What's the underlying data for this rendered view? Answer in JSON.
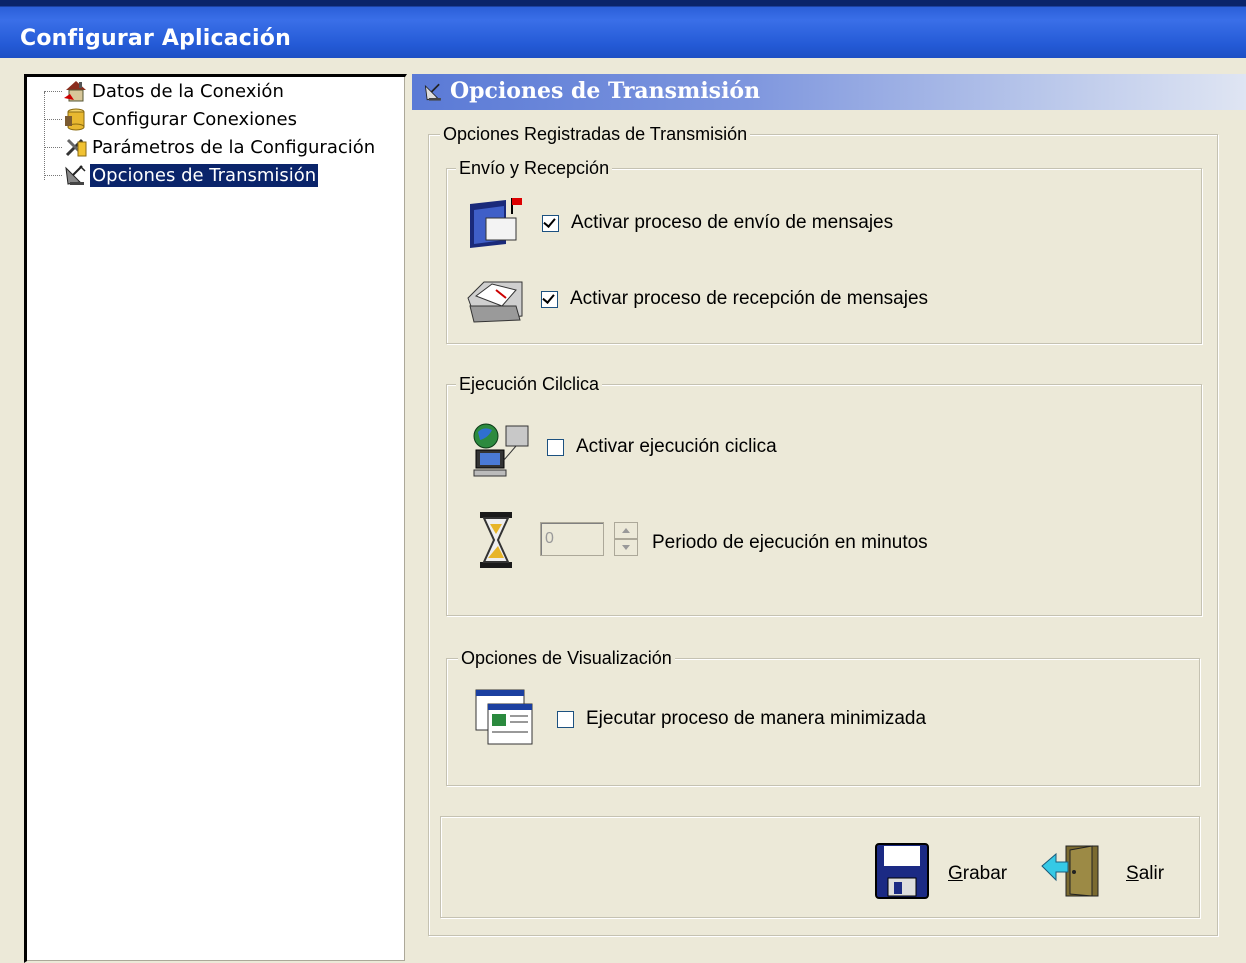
{
  "window": {
    "title": "Configurar Aplicación"
  },
  "tree": {
    "items": [
      {
        "label": "Datos de la Conexión",
        "icon": "house-connection-icon"
      },
      {
        "label": "Configurar Conexiones",
        "icon": "database-config-icon"
      },
      {
        "label": "Parámetros de la Configuración",
        "icon": "tools-icon"
      },
      {
        "label": "Opciones de Transmisión",
        "icon": "satellite-icon",
        "selected": true
      }
    ]
  },
  "panel": {
    "title": "Opciones de Transmisión",
    "outer_group": "Opciones Registradas de Transmisión",
    "envio": {
      "title": "Envío y Recepción",
      "send_label": "Activar proceso de envío de mensajes",
      "send_checked": true,
      "recv_label": "Activar proceso de recepción de mensajes",
      "recv_checked": true
    },
    "ciclica": {
      "title": "Ejecución Cilclica",
      "cyclic_label": "Activar ejecución ciclica",
      "cyclic_checked": false,
      "period_value": "0",
      "period_label": "Periodo de ejecución en minutos"
    },
    "visual": {
      "title": "Opciones de Visualización",
      "min_label": "Ejecutar proceso de manera minimizada",
      "min_checked": false
    },
    "buttons": {
      "save_first": "G",
      "save_rest": "rabar",
      "exit_first": "S",
      "exit_rest": "alir"
    }
  }
}
